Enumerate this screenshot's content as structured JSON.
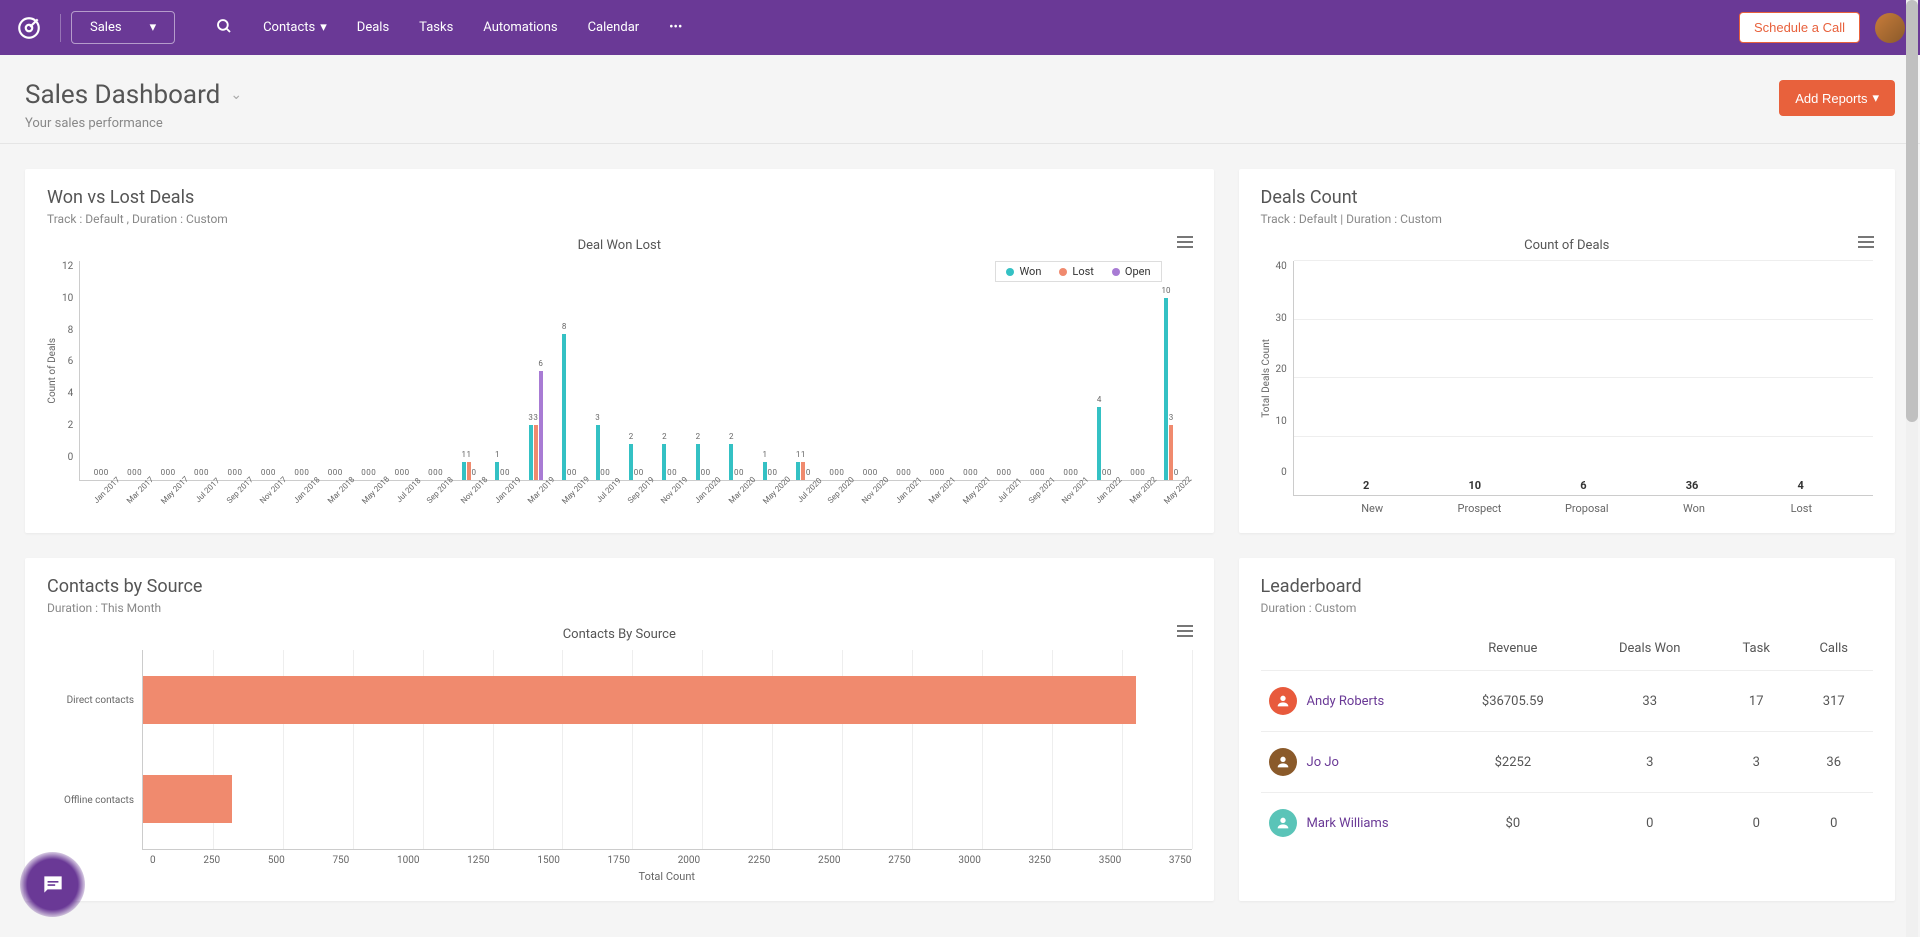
{
  "nav": {
    "module": "Sales",
    "items": [
      "Contacts",
      "Deals",
      "Tasks",
      "Automations",
      "Calendar"
    ],
    "schedule_btn": "Schedule a Call"
  },
  "header": {
    "title": "Sales Dashboard",
    "subtitle": "Your sales performance",
    "add_reports": "Add Reports"
  },
  "wonlost": {
    "title": "Won vs Lost Deals",
    "meta": "Track : Default ,  Duration : Custom",
    "chart_title": "Deal Won Lost",
    "legend": {
      "won": "Won",
      "lost": "Lost",
      "open": "Open"
    },
    "ylabel": "Count of Deals"
  },
  "dealscount": {
    "title": "Deals Count",
    "meta": "Track : Default | Duration : Custom",
    "chart_title": "Count of Deals",
    "ylabel": "Total Deals Count"
  },
  "contacts": {
    "title": "Contacts by Source",
    "meta": "Duration : This Month",
    "chart_title": "Contacts By Source",
    "xlabel": "Total Count"
  },
  "leaderboard": {
    "title": "Leaderboard",
    "meta": "Duration : Custom",
    "headers": [
      "",
      "Revenue",
      "Deals Won",
      "Task",
      "Calls"
    ],
    "rows": [
      {
        "name": "Andy Roberts",
        "revenue": "$36705.59",
        "deals": "33",
        "task": "17",
        "calls": "317",
        "avatar": "#e85a3c"
      },
      {
        "name": "Jo Jo",
        "revenue": "$2252",
        "deals": "3",
        "task": "3",
        "calls": "36",
        "avatar": "#8a5a2a"
      },
      {
        "name": "Mark Williams",
        "revenue": "$0",
        "deals": "0",
        "task": "0",
        "calls": "0",
        "avatar": "#5ac4b8"
      }
    ]
  },
  "chart_data": [
    {
      "id": "won_vs_lost",
      "type": "bar",
      "title": "Deal Won Lost",
      "ylabel": "Count of Deals",
      "ylim": [
        0,
        12
      ],
      "yticks": [
        0,
        2,
        4,
        6,
        8,
        10,
        12
      ],
      "categories": [
        "Jan 2017",
        "Mar 2017",
        "May 2017",
        "Jul 2017",
        "Sep 2017",
        "Nov 2017",
        "Jan 2018",
        "Mar 2018",
        "May 2018",
        "Jul 2018",
        "Sep 2018",
        "Nov 2018",
        "Jan 2019",
        "Mar 2019",
        "May 2019",
        "Jul 2019",
        "Sep 2019",
        "Nov 2019",
        "Jan 2020",
        "Mar 2020",
        "May 2020",
        "Jul 2020",
        "Sep 2020",
        "Nov 2020",
        "Jan 2021",
        "Mar 2021",
        "May 2021",
        "Jul 2021",
        "Sep 2021",
        "Nov 2021",
        "Jan 2022",
        "Mar 2022",
        "May 2022"
      ],
      "series": [
        {
          "name": "Won",
          "color": "#34c1c4",
          "values": [
            0,
            0,
            0,
            0,
            0,
            0,
            0,
            0,
            0,
            0,
            0,
            1,
            1,
            3,
            8,
            3,
            2,
            2,
            2,
            2,
            1,
            1,
            0,
            0,
            0,
            0,
            0,
            0,
            0,
            0,
            4,
            0,
            10
          ]
        },
        {
          "name": "Lost",
          "color": "#f08a6e",
          "values": [
            0,
            0,
            0,
            0,
            0,
            0,
            0,
            0,
            0,
            0,
            0,
            1,
            0,
            3,
            0,
            0,
            0,
            0,
            0,
            0,
            0,
            1,
            0,
            0,
            0,
            0,
            0,
            0,
            0,
            0,
            0,
            0,
            3
          ]
        },
        {
          "name": "Open",
          "color": "#a87bd4",
          "values": [
            0,
            0,
            0,
            0,
            0,
            0,
            0,
            0,
            0,
            0,
            0,
            0,
            0,
            6,
            0,
            0,
            0,
            0,
            0,
            0,
            0,
            0,
            0,
            0,
            0,
            0,
            0,
            0,
            0,
            0,
            0,
            0,
            0
          ]
        }
      ]
    },
    {
      "id": "deals_count",
      "type": "bar",
      "title": "Count of Deals",
      "ylabel": "Total Deals Count",
      "ylim": [
        0,
        40
      ],
      "yticks": [
        0,
        10,
        20,
        30,
        40
      ],
      "categories": [
        "New",
        "Prospect",
        "Proposal",
        "Won",
        "Lost"
      ],
      "values": [
        2,
        10,
        6,
        36,
        4
      ],
      "color": "#6cc034"
    },
    {
      "id": "contacts_by_source",
      "type": "bar",
      "orientation": "horizontal",
      "title": "Contacts By Source",
      "xlabel": "Total Count",
      "xlim": [
        0,
        3750
      ],
      "xticks": [
        0,
        250,
        500,
        750,
        1000,
        1250,
        1500,
        1750,
        2000,
        2250,
        2500,
        2750,
        3000,
        3250,
        3500,
        3750
      ],
      "categories": [
        "Direct contacts",
        "Offline contacts"
      ],
      "values": [
        3550,
        320
      ],
      "color": "#f08a6e"
    }
  ]
}
